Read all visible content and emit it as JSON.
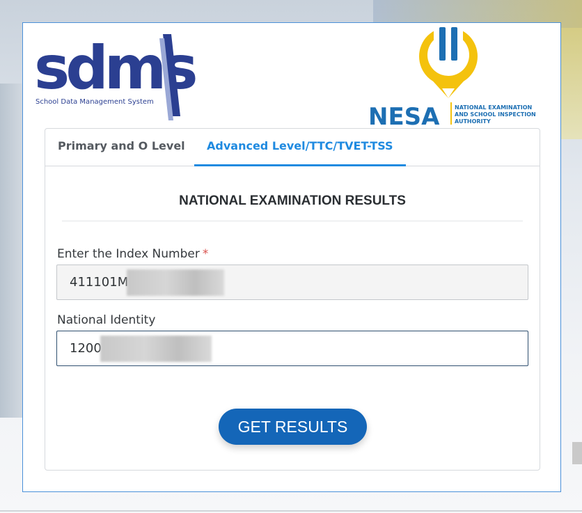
{
  "logos": {
    "sdms_text": "sdms",
    "sdms_tagline": "School Data Management System",
    "nesa_text": "NESA",
    "nesa_line1": "NATIONAL EXAMINATION",
    "nesa_line2": "AND SCHOOL INSPECTION",
    "nesa_line3": "AUTHORITY"
  },
  "tabs": [
    {
      "label": "Primary and O Level",
      "active": false
    },
    {
      "label": "Advanced Level/TTC/TVET-TSS",
      "active": true
    }
  ],
  "section_title": "NATIONAL EXAMINATION RESULTS",
  "form": {
    "index_label": "Enter the Index Number",
    "required_mark": "*",
    "index_value": "411101M",
    "nid_label": "National Identity",
    "nid_value": "1200"
  },
  "submit_label": "GET RESULTS",
  "colors": {
    "accent": "#1f8ae0",
    "button": "#1466b8",
    "frame_border": "#4a90d9",
    "sdms_navy": "#2b3f91",
    "nesa_blue": "#1d6fb3",
    "nesa_yellow": "#f4c20d"
  }
}
